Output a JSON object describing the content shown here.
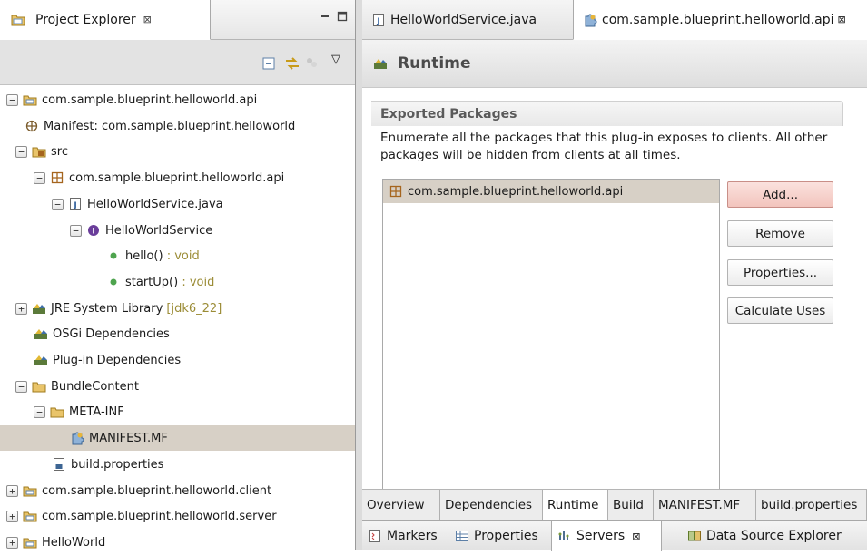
{
  "left_view": {
    "tab_label": "Project Explorer",
    "close_glyph": "⊠",
    "minimize_glyph": "▭",
    "maximize_glyph": "□",
    "menu_glyph": "▽"
  },
  "tree": [
    {
      "label": "com.sample.blueprint.helloworld.api",
      "suffix": "",
      "expander": "−",
      "icon": "project-folder-icon",
      "depth": 0
    },
    {
      "label": "Manifest: com.sample.blueprint.helloworld",
      "suffix": "",
      "expander": "",
      "icon": "manifest-icon",
      "depth": 1
    },
    {
      "label": "src",
      "suffix": "",
      "expander": "−",
      "icon": "source-folder-icon",
      "depth": 0.5
    },
    {
      "label": "com.sample.blueprint.helloworld.api",
      "suffix": "",
      "expander": "−",
      "icon": "package-icon",
      "depth": 1.5
    },
    {
      "label": "HelloWorldService.java",
      "suffix": "",
      "expander": "−",
      "icon": "java-file-icon",
      "depth": 2.5
    },
    {
      "label": "HelloWorldService",
      "suffix": "",
      "expander": "−",
      "icon": "interface-icon",
      "depth": 3.5
    },
    {
      "label": "hello()",
      "suffix": " : void",
      "expander": "",
      "icon": "method-icon",
      "depth": 5.5
    },
    {
      "label": "startUp()",
      "suffix": " : void",
      "expander": "",
      "icon": "method-icon",
      "depth": 5.5
    },
    {
      "label": "JRE System Library",
      "suffix": " [jdk6_22]",
      "expander": "+",
      "icon": "library-icon",
      "depth": 0.5
    },
    {
      "label": "OSGi Dependencies",
      "suffix": "",
      "expander": "",
      "icon": "library-icon",
      "depth": 1.5
    },
    {
      "label": "Plug-in Dependencies",
      "suffix": "",
      "expander": "",
      "icon": "library-icon",
      "depth": 1.5
    },
    {
      "label": "BundleContent",
      "suffix": "",
      "expander": "−",
      "icon": "folder-icon",
      "depth": 0.5
    },
    {
      "label": "META-INF",
      "suffix": "",
      "expander": "−",
      "icon": "folder-icon",
      "depth": 1.5
    },
    {
      "label": "MANIFEST.MF",
      "suffix": "",
      "expander": "",
      "icon": "manifest-file-icon",
      "depth": 3.5,
      "selected": true
    },
    {
      "label": "build.properties",
      "suffix": "",
      "expander": "",
      "icon": "properties-file-icon",
      "depth": 2.5
    },
    {
      "label": "com.sample.blueprint.helloworld.client",
      "suffix": "",
      "expander": "+",
      "icon": "project-folder-icon",
      "depth": 0
    },
    {
      "label": "com.sample.blueprint.helloworld.server",
      "suffix": "",
      "expander": "+",
      "icon": "project-folder-icon",
      "depth": 0
    },
    {
      "label": "HelloWorld",
      "suffix": "",
      "expander": "+",
      "icon": "project-folder-icon",
      "depth": 0
    }
  ],
  "editor": {
    "tabs": [
      {
        "label": "HelloWorldService.java",
        "active": false
      },
      {
        "label": "com.sample.blueprint.helloworld.api",
        "active": true
      }
    ],
    "tab_close_glyph": "⊠",
    "page_title": "Runtime",
    "section": {
      "title": "Exported Packages",
      "description": "Enumerate all the packages that this plug-in exposes to clients.  All other packages will be hidden from clients at all times.",
      "packages": [
        "com.sample.blueprint.helloworld.api"
      ]
    },
    "buttons": {
      "add": "Add...",
      "remove": "Remove",
      "properties": "Properties...",
      "calculate_uses": "Calculate Uses"
    },
    "page_tabs": [
      "Overview",
      "Dependencies",
      "Runtime",
      "Build",
      "MANIFEST.MF",
      "build.properties"
    ],
    "active_page_tab": "Runtime"
  },
  "bottom_views": {
    "tabs": [
      "Markers",
      "Properties",
      "Servers",
      "Data Source Explorer"
    ],
    "active": "Servers",
    "close_glyph": "⊠"
  },
  "colors": {
    "selection": "#d7d0c6",
    "decoration": "#9b8c36",
    "primary_button": "#f2c4bd"
  }
}
